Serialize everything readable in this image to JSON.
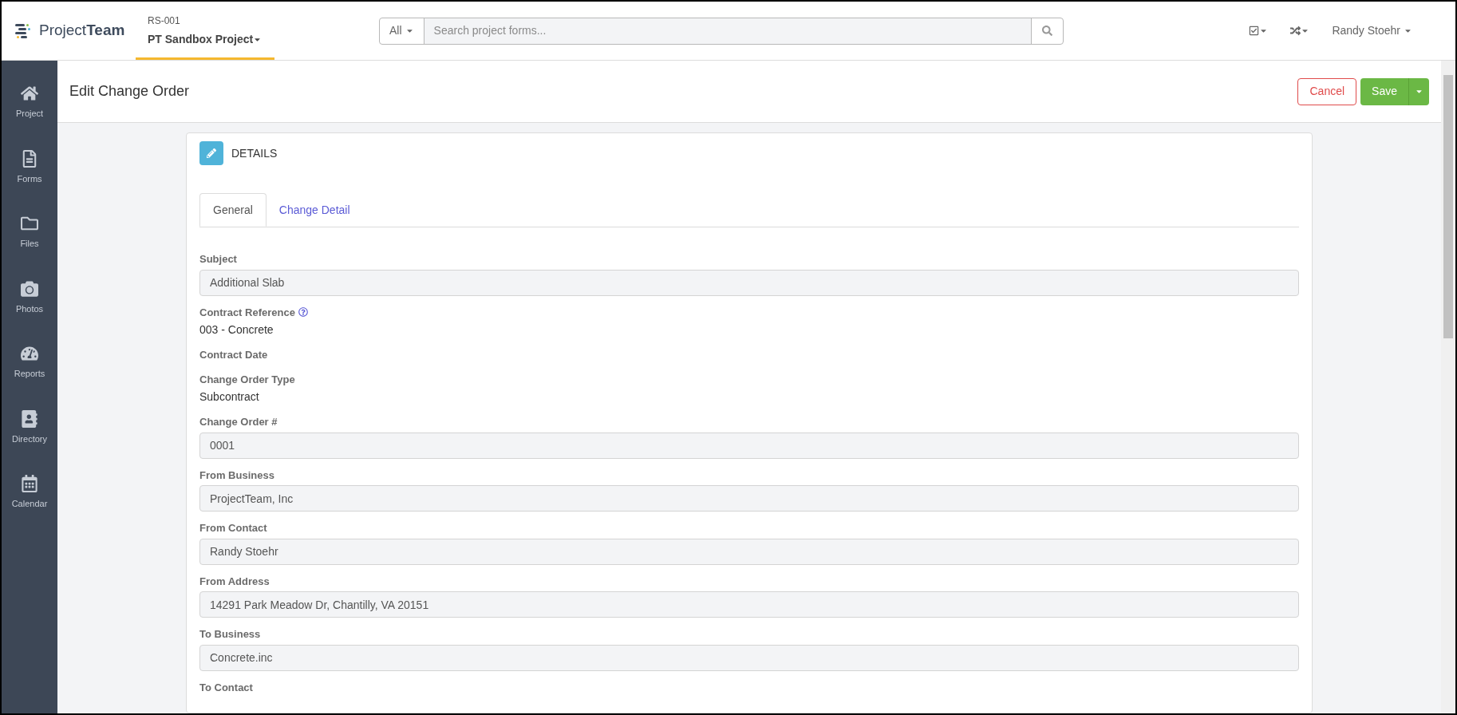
{
  "header": {
    "logo": {
      "light": "Project",
      "bold": "Team"
    },
    "project_code": "RS-001",
    "project_name": "PT Sandbox Project",
    "search": {
      "scope": "All",
      "placeholder": "Search project forms..."
    },
    "user": "Randy Stoehr"
  },
  "sidebar": {
    "items": [
      {
        "label": "Project"
      },
      {
        "label": "Forms"
      },
      {
        "label": "Files"
      },
      {
        "label": "Photos"
      },
      {
        "label": "Reports"
      },
      {
        "label": "Directory"
      },
      {
        "label": "Calendar"
      }
    ]
  },
  "page": {
    "title": "Edit Change Order",
    "buttons": {
      "cancel": "Cancel",
      "save": "Save"
    }
  },
  "card": {
    "title": "DETAILS",
    "tabs": [
      {
        "label": "General",
        "selected": true
      },
      {
        "label": "Change Detail",
        "selected": false
      }
    ],
    "fields": [
      {
        "label": "Subject",
        "kind": "input",
        "value": "Additional Slab"
      },
      {
        "label": "Contract Reference",
        "kind": "text",
        "help": true,
        "value": "003 - Concrete"
      },
      {
        "label": "Contract Date",
        "kind": "text"
      },
      {
        "label": "Change Order Type",
        "kind": "text",
        "value": "Subcontract"
      },
      {
        "label": "Change Order #",
        "kind": "input",
        "value": "0001"
      },
      {
        "label": "From Business",
        "kind": "input",
        "value": "ProjectTeam, Inc"
      },
      {
        "label": "From Contact",
        "kind": "input",
        "value": "Randy Stoehr"
      },
      {
        "label": "From Address",
        "kind": "input",
        "value": "14291 Park Meadow Dr, Chantilly, VA 20151"
      },
      {
        "label": "To Business",
        "kind": "input",
        "value": "Concrete.inc"
      },
      {
        "label": "To Contact",
        "kind": "label"
      }
    ]
  }
}
